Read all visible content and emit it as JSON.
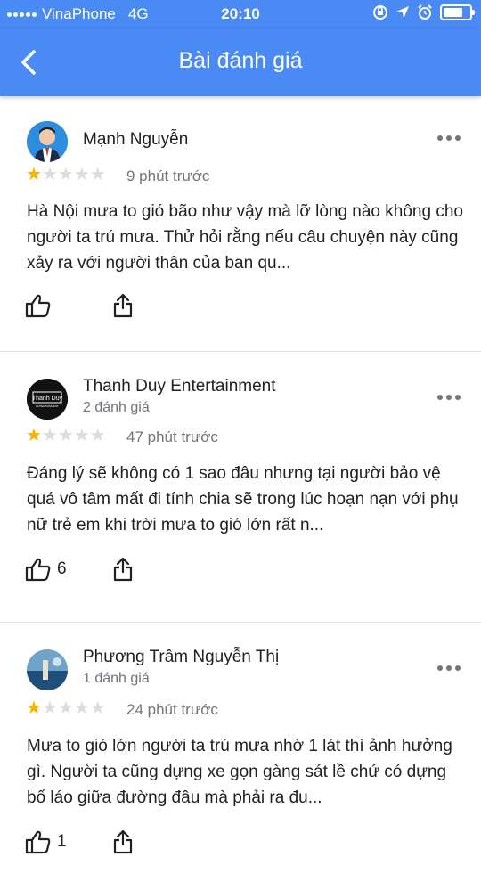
{
  "status_bar": {
    "carrier": "VinaPhone",
    "network": "4G",
    "time": "20:10",
    "battery_level": 0.82
  },
  "header": {
    "title": "Bài đánh giá"
  },
  "reviews": [
    {
      "author": "Mạnh Nguyễn",
      "review_count": "",
      "stars": 1,
      "max_stars": 5,
      "time_ago": "9 phút trước",
      "text": "Hà Nội mưa to gió bão như vậy mà lỡ lòng nào không cho người ta trú mưa. Thử hỏi rằng nếu câu chuyện này cũng xảy ra với người thân của ban qu...",
      "likes": ""
    },
    {
      "author": "Thanh Duy Entertainment",
      "review_count": "2 đánh giá",
      "stars": 1,
      "max_stars": 5,
      "time_ago": "47 phút trước",
      "text": "Đáng lý sẽ không có 1 sao đâu nhưng tại người bảo vệ quá vô tâm mất đi tính chia sẽ trong lúc hoạn nạn với phụ nữ trẻ em khi trời mưa to gió lớn rất n...",
      "likes": "6",
      "avatar_text": "Thanh Duy",
      "avatar_subtext": "ENTERTAINMENT"
    },
    {
      "author": "Phương Trâm Nguyễn Thị",
      "review_count": "1 đánh giá",
      "stars": 1,
      "max_stars": 5,
      "time_ago": "24 phút trước",
      "text": "Mưa to gió lớn người ta trú mưa nhờ 1 lát thì ảnh hưởng gì. Người ta cũng dựng xe gọn gàng sát lề chứ có dựng bố láo giữa đường đâu mà phải ra đu...",
      "likes": "1"
    }
  ],
  "colors": {
    "primary": "#4a8af4",
    "star_on": "#f6b400",
    "star_off": "#dadce0"
  }
}
